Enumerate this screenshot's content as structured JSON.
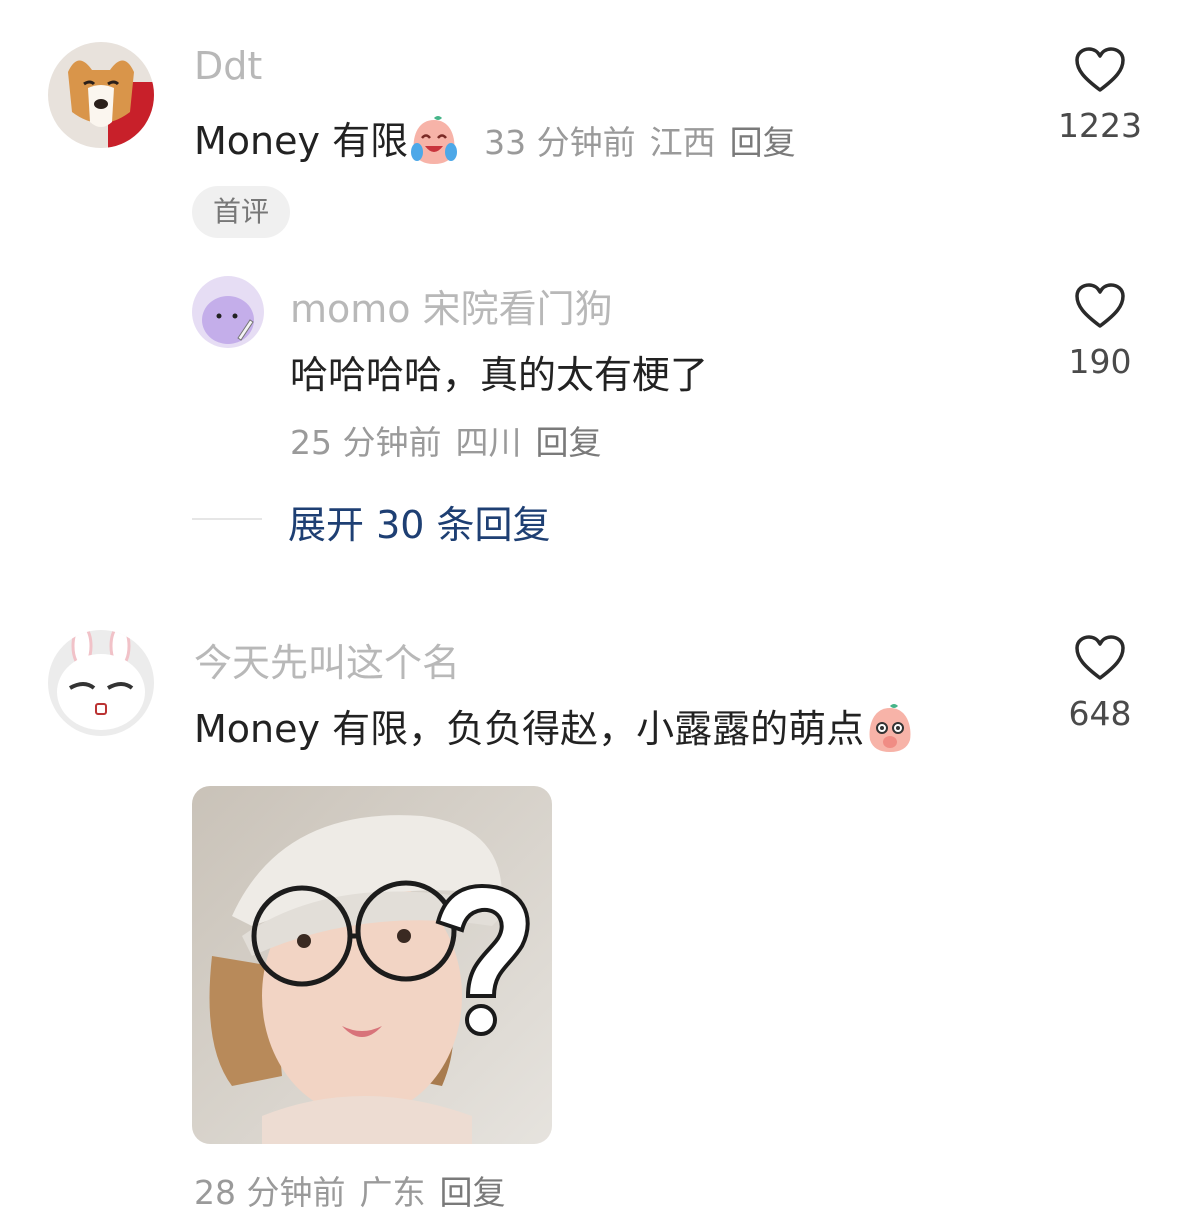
{
  "comments": [
    {
      "username": "Ddt",
      "text": "Money 有限",
      "emoji": "crying-laughing-peach-emoji",
      "time": "33 分钟前",
      "location": "江西",
      "reply_label": "回复",
      "likes": "1223",
      "badge": "首评",
      "avatar": "corgi-with-coke-avatar",
      "replies": [
        {
          "username": "momo 宋院看门狗",
          "text": "哈哈哈哈，真的太有梗了",
          "time": "25 分钟前",
          "location": "四川",
          "reply_label": "回复",
          "likes": "190",
          "avatar": "purple-dino-with-knife-avatar"
        }
      ],
      "expand_label": "展开 30 条回复"
    },
    {
      "username": "今天先叫这个名",
      "text": "Money 有限，负负得赵，小露露的萌点",
      "emoji": "shy-peach-emoji",
      "time": "28 分钟前",
      "location": "广东",
      "reply_label": "回复",
      "likes": "648",
      "avatar": "white-bunny-avatar",
      "image": "girl-with-cap-and-glasses-question-mark"
    }
  ],
  "colors": {
    "username": "#b8b8b8",
    "text": "#222222",
    "meta": "#9a9a9a",
    "expand_link": "#1e3f73"
  },
  "icons": [
    "heart-outline-icon"
  ]
}
